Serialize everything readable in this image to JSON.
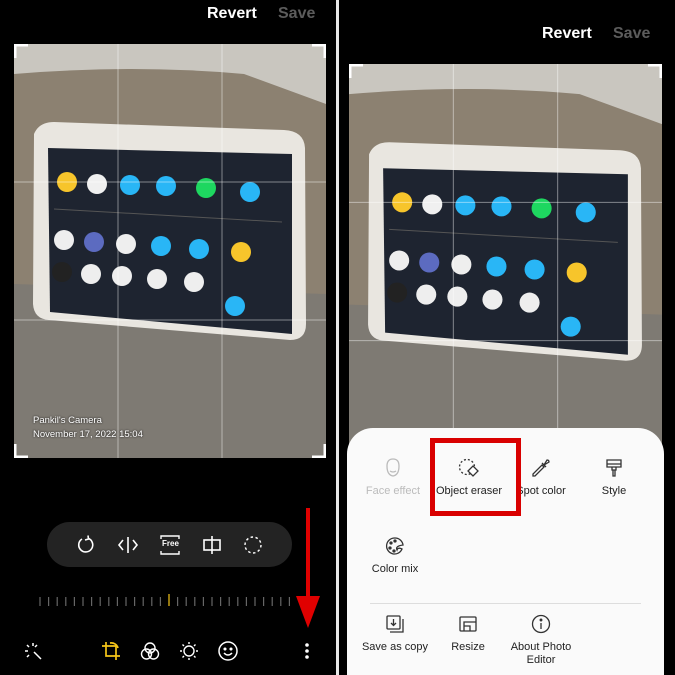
{
  "left_screen": {
    "top_bar": {
      "revert_label": "Revert",
      "save_label": "Save"
    },
    "photo_watermark": {
      "camera": "Pankil's Camera",
      "datetime": "November 17, 2022 15:04"
    },
    "transform_tools": [
      {
        "icon": "rotate-icon"
      },
      {
        "icon": "flip-icon"
      },
      {
        "icon": "free-aspect-icon",
        "label": "Free"
      },
      {
        "icon": "perspective-icon"
      },
      {
        "icon": "lasso-icon"
      }
    ],
    "straighten_value": 0,
    "bottom_toolbar": [
      {
        "icon": "auto-enhance-icon"
      },
      {
        "icon": "crop-rotate-icon",
        "active": true
      },
      {
        "icon": "filters-icon"
      },
      {
        "icon": "brightness-icon"
      },
      {
        "icon": "face-sticker-icon"
      },
      {
        "icon": "more-options-icon"
      }
    ],
    "annotation": {
      "type": "arrow-down",
      "color": "#e00000"
    }
  },
  "right_screen": {
    "top_bar": {
      "revert_label": "Revert",
      "save_label": "Save"
    },
    "more_menu": {
      "tools": [
        {
          "label": "Face effect",
          "icon": "face-icon",
          "enabled": false
        },
        {
          "label": "Object eraser",
          "icon": "object-eraser-icon",
          "enabled": true,
          "highlighted": true
        },
        {
          "label": "Spot color",
          "icon": "dropper-icon",
          "enabled": true
        },
        {
          "label": "Style",
          "icon": "paint-roller-icon",
          "enabled": true
        },
        {
          "label": "Color mix",
          "icon": "palette-icon",
          "enabled": true
        }
      ],
      "actions": [
        {
          "label": "Save as copy",
          "icon": "save-copy-icon"
        },
        {
          "label": "Resize",
          "icon": "resize-icon"
        },
        {
          "label": "About Photo Editor",
          "icon": "info-icon"
        }
      ]
    },
    "highlight_color": "#d90000"
  },
  "accent_color": "#f5c518"
}
